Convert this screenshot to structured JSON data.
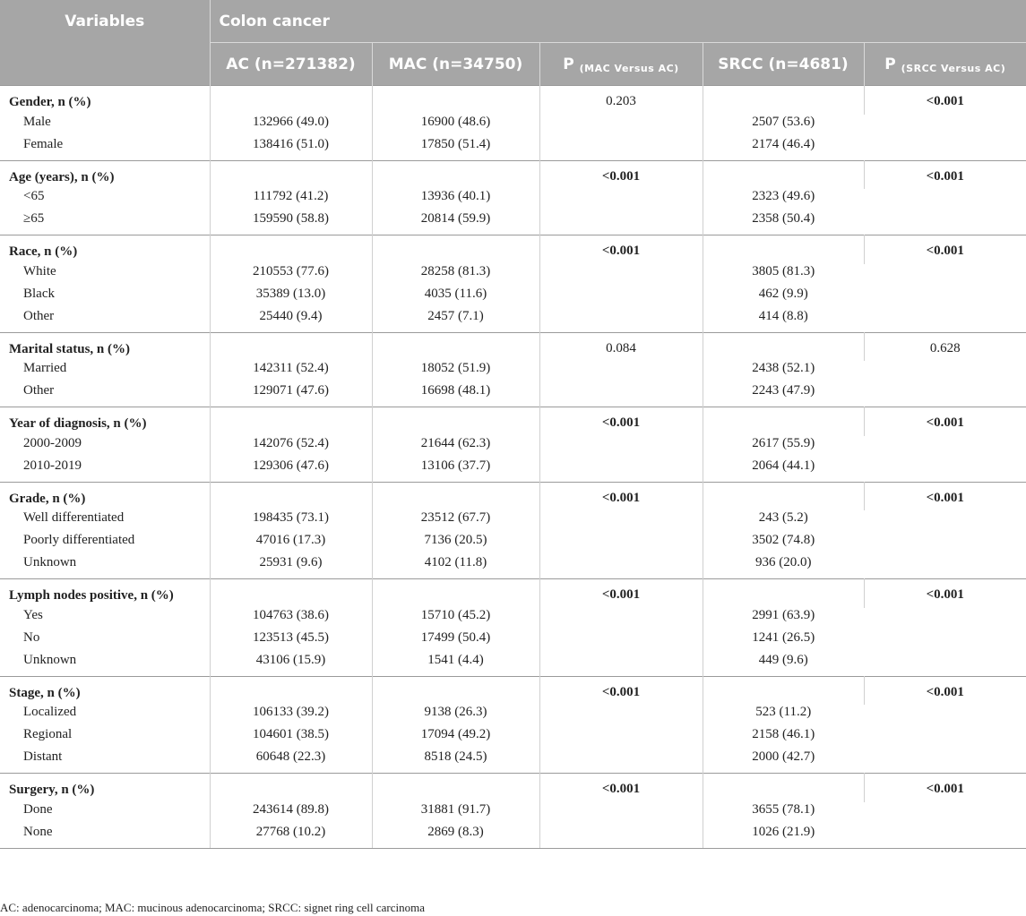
{
  "header": {
    "variables": "Variables",
    "colon": "Colon cancer",
    "ac": "AC (n=271382)",
    "mac": "MAC (n=34750)",
    "p_mac_main": "P",
    "p_mac_sub": "(MAC Versus AC)",
    "srcc": "SRCC (n=4681)",
    "p_srcc_main": "P",
    "p_srcc_sub": "(SRCC Versus AC)"
  },
  "groups": [
    {
      "name": "Gender, n (%)",
      "p_mac": "0.203",
      "p_mac_bold": false,
      "p_srcc": "<0.001",
      "p_srcc_bold": true,
      "rows": [
        {
          "label": "Male",
          "ac": "132966 (49.0)",
          "mac": "16900 (48.6)",
          "srcc": "2507 (53.6)"
        },
        {
          "label": "Female",
          "ac": "138416 (51.0)",
          "mac": "17850 (51.4)",
          "srcc": "2174 (46.4)"
        }
      ]
    },
    {
      "name": "Age (years), n (%)",
      "p_mac": "<0.001",
      "p_mac_bold": true,
      "p_srcc": "<0.001",
      "p_srcc_bold": true,
      "rows": [
        {
          "label": "<65",
          "ac": "111792 (41.2)",
          "mac": "13936 (40.1)",
          "srcc": "2323 (49.6)"
        },
        {
          "label": "≥65",
          "ac": "159590 (58.8)",
          "mac": "20814 (59.9)",
          "srcc": "2358 (50.4)"
        }
      ]
    },
    {
      "name": "Race, n (%)",
      "p_mac": "<0.001",
      "p_mac_bold": true,
      "p_srcc": "<0.001",
      "p_srcc_bold": true,
      "rows": [
        {
          "label": "White",
          "ac": "210553 (77.6)",
          "mac": "28258 (81.3)",
          "srcc": "3805 (81.3)"
        },
        {
          "label": "Black",
          "ac": "35389 (13.0)",
          "mac": "4035 (11.6)",
          "srcc": "462 (9.9)"
        },
        {
          "label": "Other",
          "ac": "25440 (9.4)",
          "mac": "2457 (7.1)",
          "srcc": "414 (8.8)"
        }
      ]
    },
    {
      "name": "Marital status, n (%)",
      "p_mac": "0.084",
      "p_mac_bold": false,
      "p_srcc": "0.628",
      "p_srcc_bold": false,
      "rows": [
        {
          "label": "Married",
          "ac": "142311 (52.4)",
          "mac": "18052 (51.9)",
          "srcc": "2438 (52.1)"
        },
        {
          "label": "Other",
          "ac": "129071 (47.6)",
          "mac": "16698 (48.1)",
          "srcc": "2243 (47.9)"
        }
      ]
    },
    {
      "name": "Year of diagnosis, n (%)",
      "p_mac": "<0.001",
      "p_mac_bold": true,
      "p_srcc": "<0.001",
      "p_srcc_bold": true,
      "rows": [
        {
          "label": "2000-2009",
          "ac": "142076 (52.4)",
          "mac": "21644 (62.3)",
          "srcc": "2617 (55.9)"
        },
        {
          "label": "2010-2019",
          "ac": "129306 (47.6)",
          "mac": "13106 (37.7)",
          "srcc": "2064 (44.1)"
        }
      ]
    },
    {
      "name": "Grade, n (%)",
      "p_mac": "<0.001",
      "p_mac_bold": true,
      "p_srcc": "<0.001",
      "p_srcc_bold": true,
      "rows": [
        {
          "label": "Well differentiated",
          "ac": "198435 (73.1)",
          "mac": "23512 (67.7)",
          "srcc": "243 (5.2)"
        },
        {
          "label": "Poorly differentiated",
          "ac": "47016 (17.3)",
          "mac": "7136 (20.5)",
          "srcc": "3502 (74.8)"
        },
        {
          "label": "Unknown",
          "ac": "25931 (9.6)",
          "mac": "4102 (11.8)",
          "srcc": "936 (20.0)"
        }
      ]
    },
    {
      "name": "Lymph nodes positive, n (%)",
      "p_mac": "<0.001",
      "p_mac_bold": true,
      "p_srcc": "<0.001",
      "p_srcc_bold": true,
      "rows": [
        {
          "label": "Yes",
          "ac": "104763 (38.6)",
          "mac": "15710 (45.2)",
          "srcc": "2991 (63.9)"
        },
        {
          "label": "No",
          "ac": "123513 (45.5)",
          "mac": "17499 (50.4)",
          "srcc": "1241 (26.5)"
        },
        {
          "label": "Unknown",
          "ac": "43106 (15.9)",
          "mac": "1541 (4.4)",
          "srcc": "449 (9.6)"
        }
      ]
    },
    {
      "name": "Stage, n (%)",
      "p_mac": "<0.001",
      "p_mac_bold": true,
      "p_srcc": "<0.001",
      "p_srcc_bold": true,
      "rows": [
        {
          "label": "Localized",
          "ac": "106133 (39.2)",
          "mac": "9138 (26.3)",
          "srcc": "523 (11.2)"
        },
        {
          "label": "Regional",
          "ac": "104601 (38.5)",
          "mac": "17094 (49.2)",
          "srcc": "2158 (46.1)"
        },
        {
          "label": "Distant",
          "ac": "60648 (22.3)",
          "mac": "8518 (24.5)",
          "srcc": "2000 (42.7)"
        }
      ]
    },
    {
      "name": "Surgery, n (%)",
      "p_mac": "<0.001",
      "p_mac_bold": true,
      "p_srcc": "<0.001",
      "p_srcc_bold": true,
      "rows": [
        {
          "label": "Done",
          "ac": "243614 (89.8)",
          "mac": "31881 (91.7)",
          "srcc": "3655 (78.1)"
        },
        {
          "label": "None",
          "ac": "27768 (10.2)",
          "mac": "2869 (8.3)",
          "srcc": "1026 (21.9)"
        }
      ]
    }
  ],
  "footnote": "AC: adenocarcinoma; MAC: mucinous adenocarcinoma; SRCC: signet ring cell carcinoma"
}
